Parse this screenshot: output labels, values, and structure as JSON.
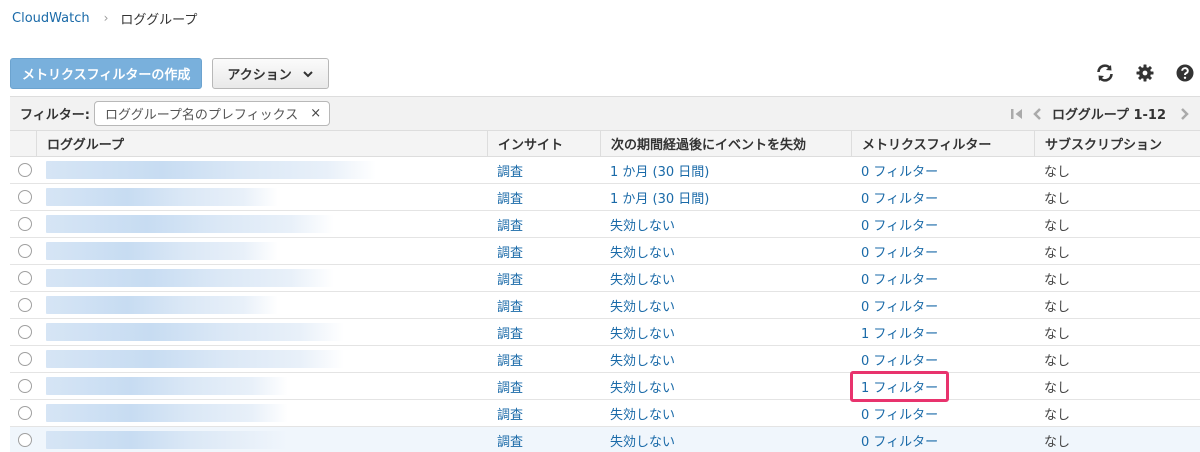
{
  "breadcrumb": {
    "root": "CloudWatch",
    "separator": "›",
    "current": "ロググループ"
  },
  "toolbar": {
    "create_metric_filter_label": "メトリクスフィルターの作成",
    "actions_label": "アクション"
  },
  "icons": {
    "refresh": "refresh-icon",
    "settings": "gear-icon",
    "help": "help-icon"
  },
  "filter": {
    "label": "フィルター:",
    "chip_text": "ロググループ名のプレフィックス",
    "chip_clear": "×"
  },
  "pager": {
    "text": "ロググループ 1-12"
  },
  "table": {
    "columns": [
      "ロググループ",
      "インサイト",
      "次の期間経過後にイベントを失効",
      "メトリクスフィルター",
      "サブスクリプション"
    ],
    "rows": [
      {
        "insight": "調査",
        "expire": "1 か月 (30 日間)",
        "metric_filter": "0 フィルター",
        "subscription": "なし"
      },
      {
        "insight": "調査",
        "expire": "1 か月 (30 日間)",
        "metric_filter": "0 フィルター",
        "subscription": "なし"
      },
      {
        "insight": "調査",
        "expire": "失効しない",
        "metric_filter": "0 フィルター",
        "subscription": "なし"
      },
      {
        "insight": "調査",
        "expire": "失効しない",
        "metric_filter": "0 フィルター",
        "subscription": "なし"
      },
      {
        "insight": "調査",
        "expire": "失効しない",
        "metric_filter": "0 フィルター",
        "subscription": "なし"
      },
      {
        "insight": "調査",
        "expire": "失効しない",
        "metric_filter": "0 フィルター",
        "subscription": "なし"
      },
      {
        "insight": "調査",
        "expire": "失効しない",
        "metric_filter": "1 フィルター",
        "subscription": "なし"
      },
      {
        "insight": "調査",
        "expire": "失効しない",
        "metric_filter": "0 フィルター",
        "subscription": "なし"
      },
      {
        "insight": "調査",
        "expire": "失効しない",
        "metric_filter": "1 フィルター",
        "subscription": "なし"
      },
      {
        "insight": "調査",
        "expire": "失効しない",
        "metric_filter": "0 フィルター",
        "subscription": "なし"
      },
      {
        "insight": "調査",
        "expire": "失効しない",
        "metric_filter": "0 フィルター",
        "subscription": "なし"
      }
    ]
  },
  "colors": {
    "link": "#1a6aa8",
    "primary_button": "#79b0dc",
    "highlight_box": "#e8336d",
    "selected_row": "#f0f6fc",
    "redacted": "#cfe0f3"
  }
}
